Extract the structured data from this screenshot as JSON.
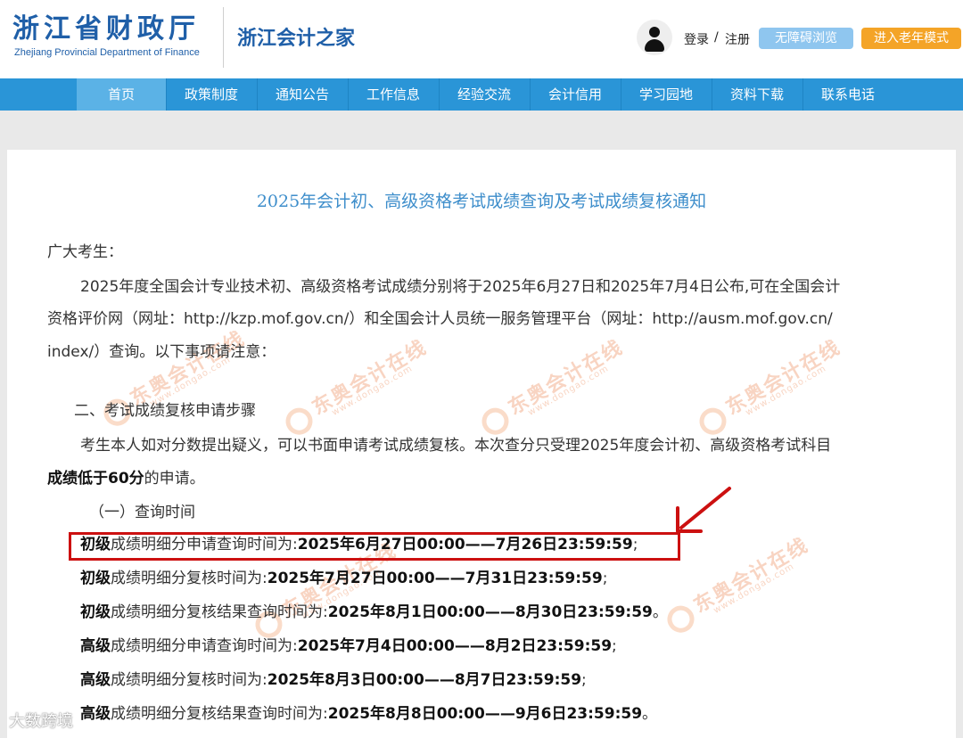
{
  "header": {
    "logo_cn": "浙江省财政厅",
    "logo_en": "Zhejiang Provincial Department of Finance",
    "site_name": "浙江会计之家",
    "login": "登录",
    "separator": "/",
    "register": "注册",
    "accessible_button": "无障碍浏览",
    "elder_mode_button": "进入老年模式"
  },
  "nav": {
    "items": [
      "首页",
      "政策制度",
      "通知公告",
      "工作信息",
      "经验交流",
      "会计信用",
      "学习园地",
      "资料下载",
      "联系电话"
    ],
    "active_index": 0
  },
  "article": {
    "title": "2025年会计初、高级资格考试成绩查询及考试成绩复核通知",
    "greeting": "广大考生：",
    "intro_line1": "2025年度全国会计专业技术初、高级资格考试成绩分别将于2025年6月27日和2025年7月4日公布,可在全国会计",
    "intro_line2": "资格评价网（网址：http://kzp.mof.gov.cn/）和全国会计人员统一服务管理平台（网址：http://ausm.mof.gov.cn/",
    "intro_line3": "index/）查询。以下事项请注意：",
    "section2_heading": "二、考试成绩复核申请步骤",
    "section2_line1": "考生本人如对分数提出疑义，可以书面申请考试成绩复核。本次查分只受理2025年度会计初、高级资格考试科目",
    "section2_line2_bold": "成绩低于60分",
    "section2_line2_rest": "的申请。",
    "subsection1": "（一）查询时间",
    "schedule": [
      {
        "level": "初级",
        "desc": "成绩明细分申请查询时间为:",
        "time": "2025年6月27日00:00——7月26日23:59:59",
        "end": ";"
      },
      {
        "level": "初级",
        "desc": "成绩明细分复核时间为:",
        "time": "2025年7月27日00:00——7月31日23:59:59",
        "end": ";"
      },
      {
        "level": "初级",
        "desc": "成绩明细分复核结果查询时间为:",
        "time": "2025年8月1日00:00——8月30日23:59:59",
        "end": "。"
      },
      {
        "level": "高级",
        "desc": "成绩明细分申请查询时间为:",
        "time": "2025年7月4日00:00——8月2日23:59:59",
        "end": ";"
      },
      {
        "level": "高级",
        "desc": "成绩明细分复核时间为:",
        "time": "2025年8月3日00:00——8月7日23:59:59",
        "end": ";"
      },
      {
        "level": "高级",
        "desc": "成绩明细分复核结果查询时间为:",
        "time": "2025年8月8日00:00——9月6日23:59:59",
        "end": "。"
      }
    ]
  },
  "watermark": {
    "text": "东奥会计在线",
    "url": "www.dongao.com"
  },
  "corner_watermark": "大数跨境",
  "colors": {
    "nav_bg": "#2a95d7",
    "nav_active": "#5bb2e6",
    "title_blue": "#3e8ecb",
    "highlight_red": "#cc1010",
    "elder_button": "#f4a427",
    "accessible_button": "#8fc6ef"
  }
}
